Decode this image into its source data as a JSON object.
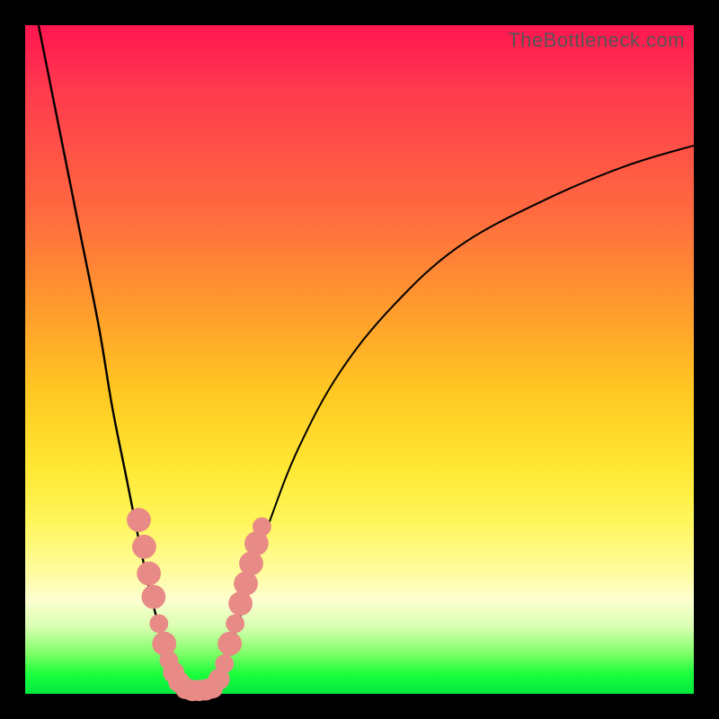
{
  "watermark": "TheBottleneck.com",
  "chart_data": {
    "type": "line",
    "title": "",
    "xlabel": "",
    "ylabel": "",
    "xlim": [
      0,
      100
    ],
    "ylim": [
      0,
      100
    ],
    "series": [
      {
        "name": "left-curve",
        "x": [
          2,
          5,
          8,
          11,
          13,
          15,
          17,
          18.5,
          20,
          21,
          22,
          23,
          24
        ],
        "y": [
          100,
          85,
          70,
          55,
          43,
          33,
          23,
          16,
          10,
          6,
          3.5,
          1.5,
          0.5
        ]
      },
      {
        "name": "right-curve",
        "x": [
          28,
          29,
          30,
          32,
          34,
          37,
          41,
          47,
          55,
          65,
          78,
          90,
          100
        ],
        "y": [
          0.5,
          2,
          5,
          11,
          18,
          27,
          37,
          48,
          58,
          67,
          74,
          79,
          82
        ]
      },
      {
        "name": "flat-bottom",
        "x": [
          24,
          25,
          26,
          27,
          28
        ],
        "y": [
          0.3,
          0.2,
          0.2,
          0.2,
          0.3
        ]
      }
    ],
    "markers": {
      "name": "salmon-dots",
      "color": "#e88a86",
      "points": [
        {
          "x": 17.0,
          "y": 26.0,
          "r": 1.8
        },
        {
          "x": 17.8,
          "y": 22.0,
          "r": 1.8
        },
        {
          "x": 18.5,
          "y": 18.0,
          "r": 1.8
        },
        {
          "x": 19.2,
          "y": 14.5,
          "r": 1.8
        },
        {
          "x": 20.0,
          "y": 10.5,
          "r": 1.4
        },
        {
          "x": 20.8,
          "y": 7.5,
          "r": 1.8
        },
        {
          "x": 21.5,
          "y": 5.0,
          "r": 1.4
        },
        {
          "x": 22.2,
          "y": 3.2,
          "r": 1.6
        },
        {
          "x": 23.0,
          "y": 1.8,
          "r": 1.6
        },
        {
          "x": 24.0,
          "y": 0.8,
          "r": 1.6
        },
        {
          "x": 25.0,
          "y": 0.5,
          "r": 1.6
        },
        {
          "x": 26.0,
          "y": 0.5,
          "r": 1.6
        },
        {
          "x": 27.0,
          "y": 0.6,
          "r": 1.6
        },
        {
          "x": 28.0,
          "y": 0.9,
          "r": 1.6
        },
        {
          "x": 29.0,
          "y": 2.2,
          "r": 1.6
        },
        {
          "x": 29.8,
          "y": 4.5,
          "r": 1.4
        },
        {
          "x": 30.6,
          "y": 7.5,
          "r": 1.8
        },
        {
          "x": 31.4,
          "y": 10.5,
          "r": 1.4
        },
        {
          "x": 32.2,
          "y": 13.5,
          "r": 1.8
        },
        {
          "x": 33.0,
          "y": 16.5,
          "r": 1.8
        },
        {
          "x": 33.8,
          "y": 19.5,
          "r": 1.8
        },
        {
          "x": 34.6,
          "y": 22.5,
          "r": 1.8
        },
        {
          "x": 35.4,
          "y": 25.0,
          "r": 1.4
        }
      ]
    }
  }
}
